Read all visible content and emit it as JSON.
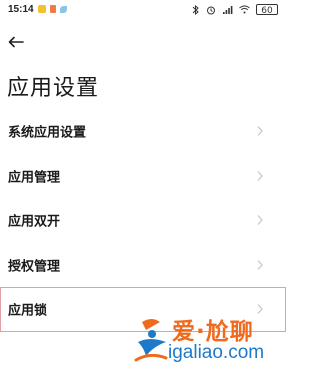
{
  "status_bar": {
    "time": "15:14",
    "battery": "60"
  },
  "header": {
    "back_icon": "arrow-left-icon",
    "title": "应用设置"
  },
  "menu": {
    "items": [
      {
        "label": "系统应用设置",
        "icon": "chevron-right-icon",
        "highlighted": false
      },
      {
        "label": "应用管理",
        "icon": "chevron-right-icon",
        "highlighted": false
      },
      {
        "label": "应用双开",
        "icon": "chevron-right-icon",
        "highlighted": false
      },
      {
        "label": "授权管理",
        "icon": "chevron-right-icon",
        "highlighted": false
      },
      {
        "label": "应用锁",
        "icon": "chevron-right-icon",
        "highlighted": true
      }
    ]
  },
  "watermark": {
    "text": "爱·尬聊",
    "domain": "igaliao.com",
    "colors": {
      "primary": "#f06a1e",
      "secondary": "#1f79c9"
    }
  },
  "colors": {
    "highlight_border": "#e0a0a8",
    "chevron": "#c8c8c8"
  }
}
